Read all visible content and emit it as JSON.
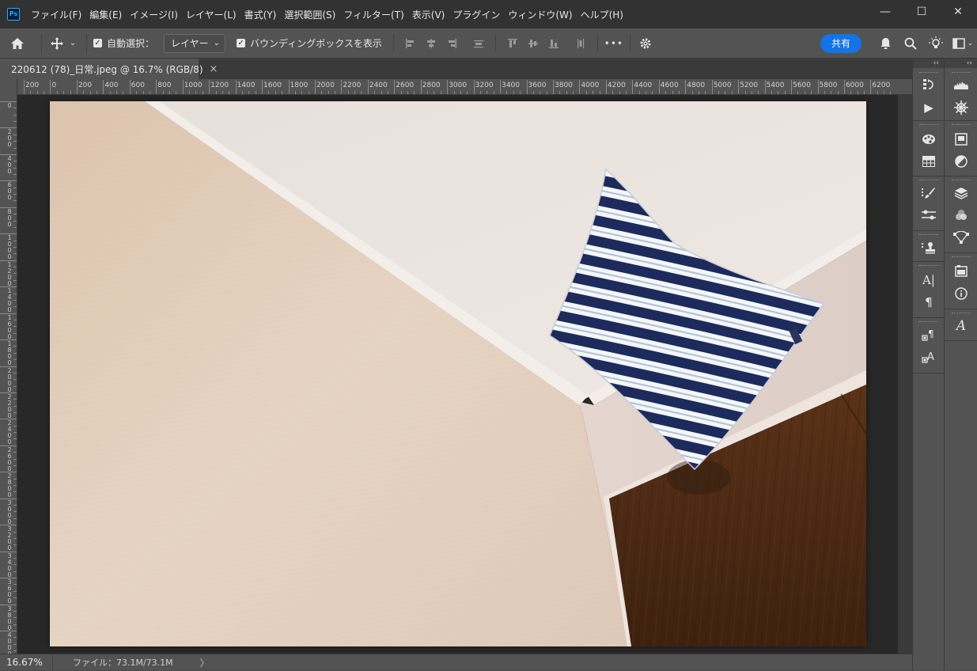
{
  "app": {
    "logo_text": "Ps"
  },
  "menu": [
    "ファイル(F)",
    "編集(E)",
    "イメージ(I)",
    "レイヤー(L)",
    "書式(Y)",
    "選択範囲(S)",
    "フィルター(T)",
    "表示(V)",
    "プラグイン",
    "ウィンドウ(W)",
    "ヘルプ(H)"
  ],
  "window_controls": {
    "minimize": "—",
    "maximize": "☐",
    "close": "✕"
  },
  "options_bar": {
    "auto_select_label": "自動選択：",
    "auto_select_checked": true,
    "layer_select_value": "レイヤー",
    "bounding_box_label": "バウンディングボックスを表示",
    "bounding_box_checked": true,
    "more": "•••",
    "share_label": "共有"
  },
  "document": {
    "tab_title": "220612 (78)_日常.jpeg @ 16.7% (RGB/8)",
    "tab_close": "×"
  },
  "ruler": {
    "h_labels": [
      "200",
      "0",
      "200",
      "400",
      "600",
      "800",
      "1000",
      "1200",
      "1400",
      "1600",
      "1800",
      "2000",
      "2200",
      "2400",
      "2600",
      "2800",
      "3000",
      "3200",
      "3400",
      "3600",
      "3800",
      "4000",
      "4200",
      "4400",
      "4600",
      "4800",
      "5000",
      "5200",
      "5400",
      "5600",
      "5800",
      "6000",
      "6200"
    ],
    "v_labels": [
      "0",
      "2 0 0",
      "4 0 0",
      "6 0 0",
      "8 0 0",
      "1 0 0 0",
      "1 2 0 0",
      "1 4 0 0",
      "1 6 0 0",
      "1 8 0 0",
      "2 0 0 0",
      "2 2 0 0",
      "2 4 0 0",
      "2 6 0 0",
      "2 8 0 0",
      "3 0 0 0",
      "3 2 0 0",
      "3 4 0 0",
      "3 6 0 0",
      "3 8 0 0",
      "4 0 0 0",
      "4 2 0 0"
    ]
  },
  "status": {
    "zoom": "16.67%",
    "file_info": "ファイル：73.1M/73.1M",
    "arrow": "〉"
  },
  "panels": {
    "collapse_glyph": "‹‹"
  },
  "colors": {
    "accent": "#1473e6",
    "wall_left": "#e6d2bf",
    "ceiling": "#ece4df",
    "door": "#4d2a12",
    "pillow_stripe": "#1c2b5c"
  }
}
